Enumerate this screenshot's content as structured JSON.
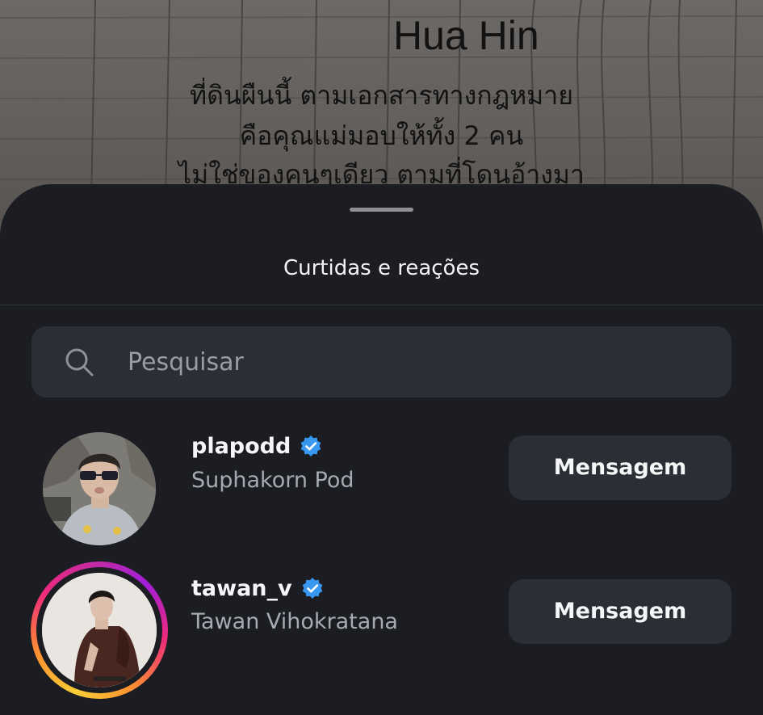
{
  "background_post": {
    "title": "Hua Hin",
    "lines": [
      "ที่ดินผืนนี้ ตามเอกสารทางกฎหมาย",
      "คือคุณแม่มอบให้ทั้ง 2 คน",
      "ไม่ใช่ของคนๆเดียว ตามที่โดนอ้างมา"
    ]
  },
  "sheet": {
    "title": "Curtidas e reações"
  },
  "search": {
    "placeholder": "Pesquisar",
    "icon": "search-icon"
  },
  "users": [
    {
      "username": "plapodd",
      "full_name": "Suphakorn Pod",
      "verified": true,
      "has_story": false,
      "button_label": "Mensagem"
    },
    {
      "username": "tawan_v",
      "full_name": "Tawan Vihokratana",
      "verified": true,
      "has_story": true,
      "button_label": "Mensagem"
    }
  ],
  "colors": {
    "sheet_background": "#1b1d22",
    "button_background": "#2b2e35",
    "verified_blue": "#3897f0",
    "secondary_text": "#a7aab0"
  }
}
